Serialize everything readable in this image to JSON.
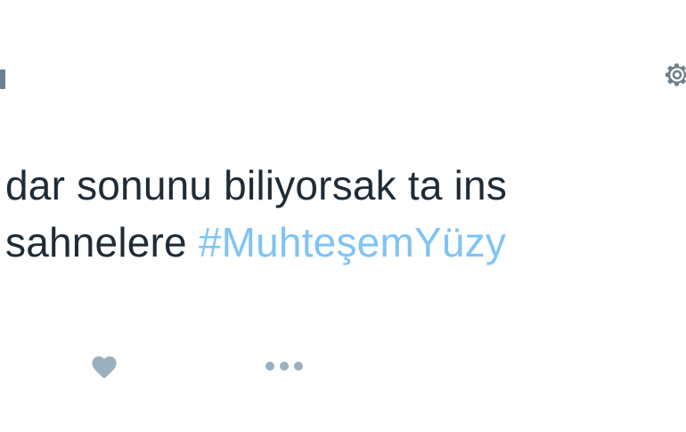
{
  "tweet": {
    "text_line_1": "dar sonunu biliyorsak ta ins",
    "text_line_2_prefix": "sahnelere ",
    "hashtag": "#MuhteşemYüzy"
  },
  "icons": {
    "settings": "gear-icon",
    "like": "heart-icon",
    "more": "more-icon"
  },
  "colors": {
    "text": "#1f2b36",
    "hashtag": "#7fc4f5",
    "icon": "#9ab0c0"
  }
}
